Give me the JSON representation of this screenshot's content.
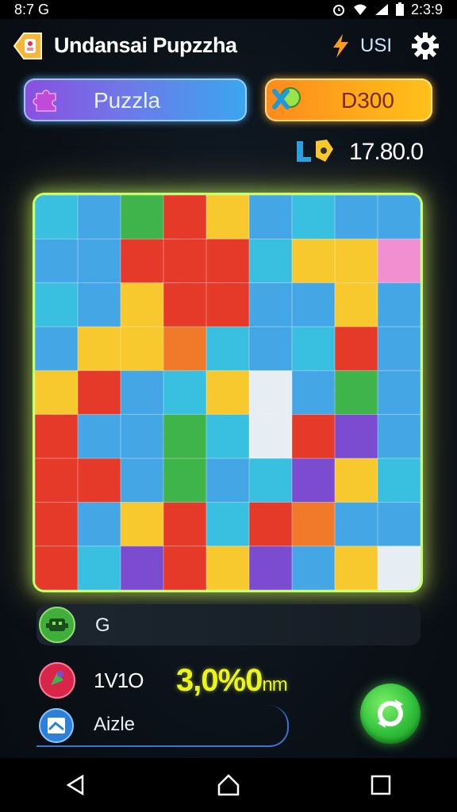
{
  "status_bar": {
    "time": "8:7 G",
    "clock": "2:3:9"
  },
  "header": {
    "title": "Undansai Pupzzha",
    "user_label": "USI"
  },
  "buttons": {
    "puzzle_label": "Puzzla",
    "coins_label": "D300"
  },
  "score": {
    "value": "17.80.0"
  },
  "board": {
    "rows": 9,
    "cols": 9,
    "colors": {
      "blue": "#45a6e6",
      "cyan": "#39c0e0",
      "red": "#e53a2a",
      "yellow": "#f7c92e",
      "green": "#3fb44a",
      "purple": "#7b4bd0",
      "white": "#e6edf3",
      "pink": "#f28fd0",
      "orange": "#f07a2a"
    },
    "grid": [
      [
        "cyan",
        "blue",
        "green",
        "red",
        "yellow",
        "blue",
        "cyan",
        "blue",
        "blue"
      ],
      [
        "blue",
        "blue",
        "red",
        "red",
        "red",
        "cyan",
        "yellow",
        "yellow",
        "pink"
      ],
      [
        "cyan",
        "blue",
        "yellow",
        "red",
        "red",
        "blue",
        "blue",
        "yellow",
        "blue"
      ],
      [
        "blue",
        "yellow",
        "yellow",
        "orange",
        "cyan",
        "blue",
        "cyan",
        "red",
        "blue"
      ],
      [
        "yellow",
        "red",
        "blue",
        "cyan",
        "yellow",
        "white",
        "blue",
        "green",
        "blue"
      ],
      [
        "red",
        "blue",
        "blue",
        "green",
        "cyan",
        "white",
        "red",
        "purple",
        "blue"
      ],
      [
        "red",
        "red",
        "blue",
        "green",
        "blue",
        "cyan",
        "purple",
        "yellow",
        "cyan"
      ],
      [
        "red",
        "blue",
        "yellow",
        "red",
        "cyan",
        "red",
        "orange",
        "blue",
        "blue"
      ],
      [
        "red",
        "cyan",
        "purple",
        "red",
        "yellow",
        "purple",
        "blue",
        "yellow",
        "white"
      ]
    ]
  },
  "footer": {
    "g_label": "G",
    "moves_label": "1V1O",
    "time_value": "3,0%0",
    "time_unit": "nm",
    "hint_label": "Aizle"
  },
  "colors": {
    "accent_green": "#c7ff6a",
    "timer_yellow": "#ecf515"
  }
}
